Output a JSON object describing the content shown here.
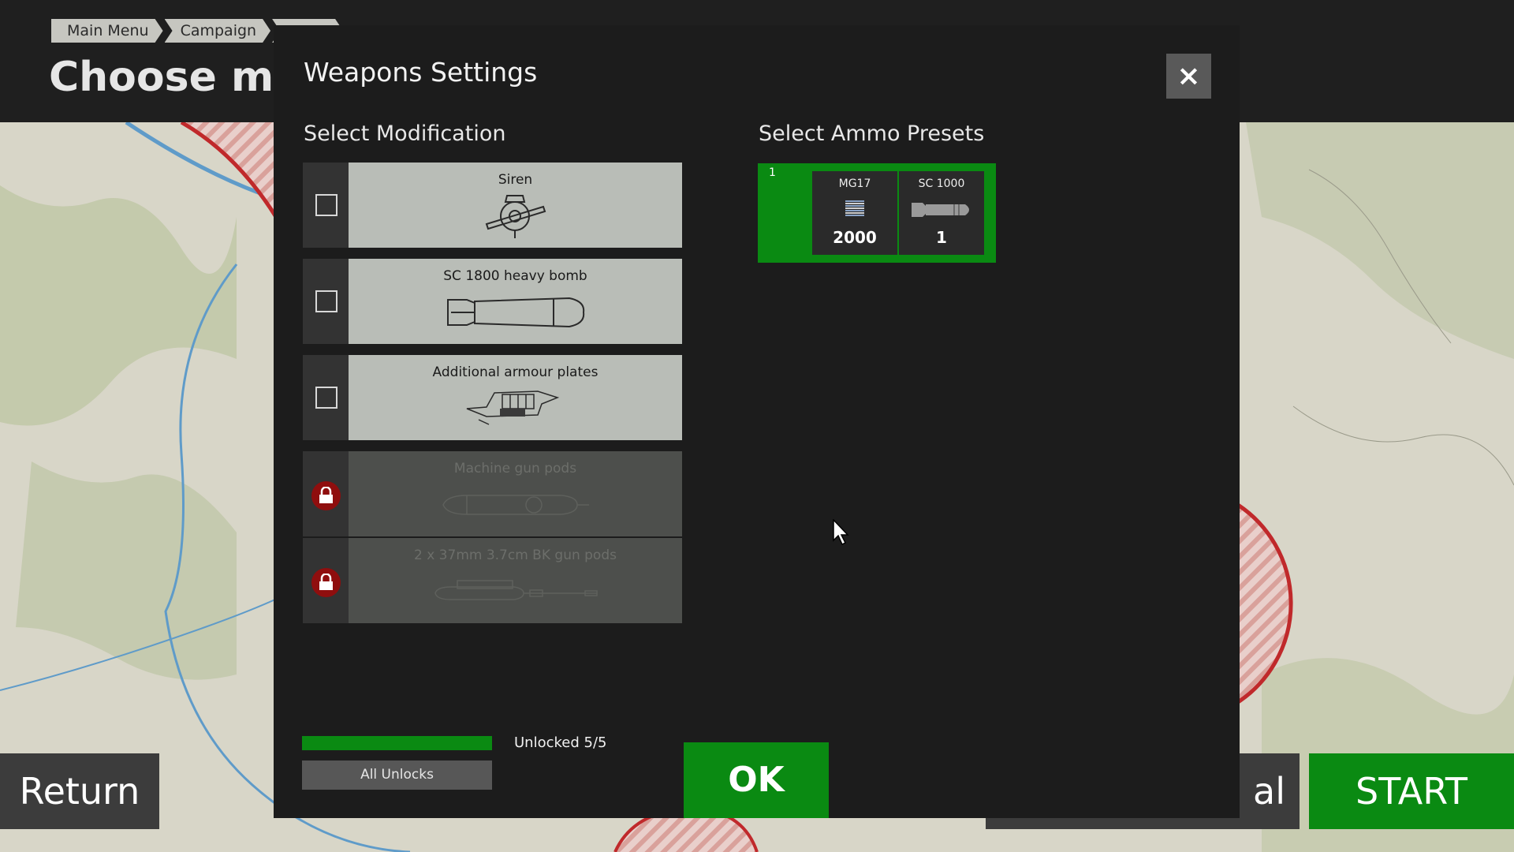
{
  "header": {
    "breadcrumb": [
      "Main Menu",
      "Campaign",
      ""
    ],
    "page_title": "Choose miss"
  },
  "bottom_bar": {
    "return_label": "Return",
    "secondary_label": "al",
    "start_label": "START"
  },
  "modal": {
    "title": "Weapons Settings",
    "close_label": "×",
    "modification_title": "Select Modification",
    "ammo_title": "Select Ammo Presets",
    "modifications": [
      {
        "name": "Siren",
        "icon": "siren-icon",
        "state": "unchecked"
      },
      {
        "name": "SC 1800 heavy bomb",
        "icon": "heavy-bomb-icon",
        "state": "unchecked"
      },
      {
        "name": "Additional armour plates",
        "icon": "armour-plates-icon",
        "state": "unchecked"
      },
      {
        "name": "Machine gun pods",
        "icon": "gun-pod-icon",
        "state": "locked"
      },
      {
        "name": "2 x 37mm 3.7cm BK gun pods",
        "icon": "cannon-pod-icon",
        "state": "locked"
      }
    ],
    "ammo_preset": {
      "number": "1",
      "slots": [
        {
          "name": "MG17",
          "count": "2000",
          "icon": "bullets-icon"
        },
        {
          "name": "SC 1000",
          "count": "1",
          "icon": "bomb-icon"
        }
      ]
    },
    "unlock_progress": 1.0,
    "unlocked_label": "Unlocked 5/5",
    "all_unlocks_label": "All Unlocks",
    "ok_label": "OK"
  },
  "colors": {
    "accent_green": "#0a8a12",
    "locked_red": "#8f0e0e",
    "panel": "#1c1c1c"
  }
}
